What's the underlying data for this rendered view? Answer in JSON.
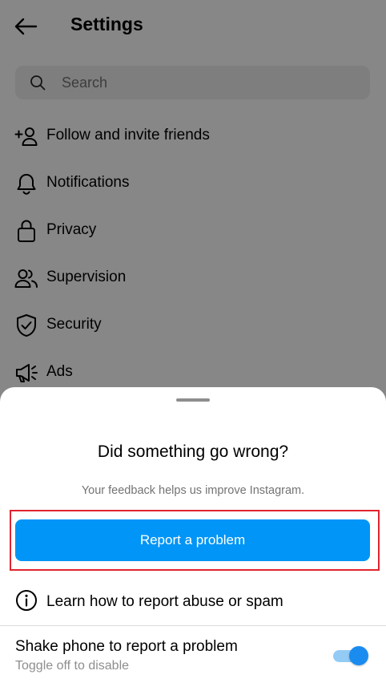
{
  "header": {
    "title": "Settings"
  },
  "search": {
    "placeholder": "Search"
  },
  "menu": {
    "items": [
      {
        "label": "Follow and invite friends",
        "icon": "add-person-icon"
      },
      {
        "label": "Notifications",
        "icon": "bell-icon"
      },
      {
        "label": "Privacy",
        "icon": "lock-icon"
      },
      {
        "label": "Supervision",
        "icon": "people-icon"
      },
      {
        "label": "Security",
        "icon": "shield-check-icon"
      },
      {
        "label": "Ads",
        "icon": "megaphone-icon"
      }
    ]
  },
  "sheet": {
    "title": "Did something go wrong?",
    "subtitle": "Your feedback helps us improve Instagram.",
    "report_button": "Report a problem",
    "learn_link": "Learn how to report abuse or spam",
    "shake": {
      "title": "Shake phone to report a problem",
      "subtitle": "Toggle off to disable",
      "enabled": true
    }
  },
  "colors": {
    "accent": "#0095f6",
    "highlight": "#e0242f",
    "toggle_on": "#1a8cf0"
  }
}
